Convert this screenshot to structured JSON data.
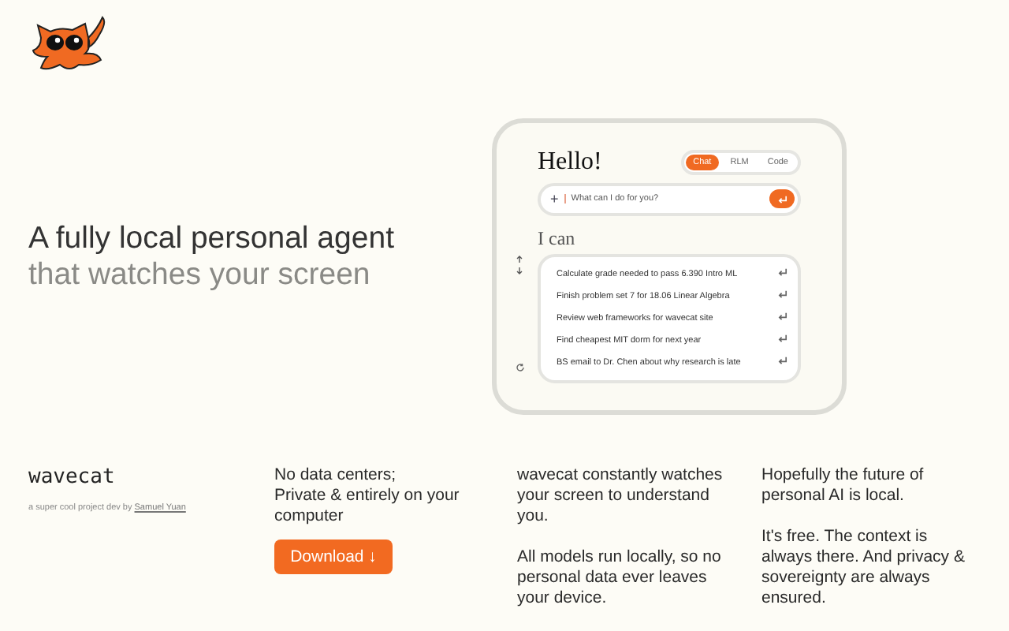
{
  "hero": {
    "headline": "A fully local personal agent",
    "subline": "that watches your screen"
  },
  "app": {
    "greeting": "Hello!",
    "modes": [
      {
        "label": "Chat",
        "selected": true
      },
      {
        "label": "RLM",
        "selected": false
      },
      {
        "label": "Code",
        "selected": false
      }
    ],
    "prompt": {
      "add": "+",
      "placeholder": "What can I do for you?"
    },
    "suggestions_title": "I can",
    "suggestions": [
      "Calculate grade needed to pass 6.390 Intro ML",
      "Finish problem set 7 for 18.06 Linear Algebra",
      "Review web frameworks for wavecat site",
      "Find cheapest MIT dorm for next year",
      "BS email to Dr. Chen about why research is late"
    ]
  },
  "footer": {
    "brand": "wavecat",
    "credit": "a super cool project dev by",
    "author": "Samuel Yuan",
    "columns": [
      {
        "lines": [
          "No data centers;",
          "Private & entirely on your computer"
        ],
        "button": "Download ↓"
      },
      {
        "paragraphs": [
          "wavecat constantly watches your screen to understand you.",
          "All models run locally, so no personal data ever leaves your device."
        ]
      },
      {
        "paragraphs": [
          "Hopefully the future of personal AI is local.",
          "It's free. The context is always there. And privacy & sovereignty are always ensured."
        ]
      }
    ]
  }
}
